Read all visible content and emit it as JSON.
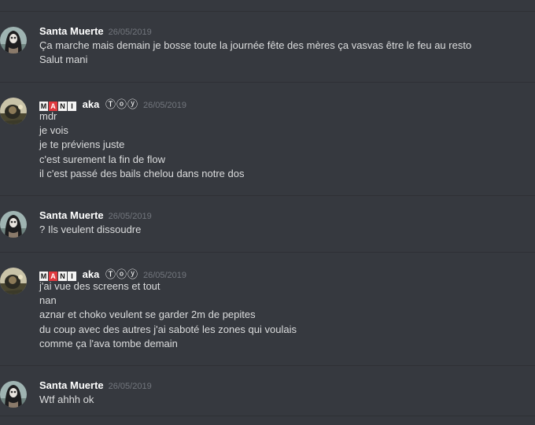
{
  "messages": [
    {
      "author": "Santa Muerte",
      "timestamp": "26/05/2019",
      "lines": [
        "Ça marche mais demain je bosse toute la journée fête des mères ça vasvas être le feu au resto",
        "Salut mani"
      ]
    },
    {
      "author_letters": [
        "M",
        "A",
        "N",
        "I"
      ],
      "author_suffix": "aka",
      "author_circled": "Ⓣⓞⓨ",
      "timestamp": "26/05/2019",
      "lines": [
        "mdr",
        "je vois",
        "je te préviens juste",
        "c'est surement la fin de flow",
        "il c'est passé des bails chelou dans notre dos"
      ]
    },
    {
      "author": "Santa Muerte",
      "timestamp": "26/05/2019",
      "lines": [
        "? Ils veulent dissoudre"
      ]
    },
    {
      "author_letters": [
        "M",
        "A",
        "N",
        "I"
      ],
      "author_suffix": "aka",
      "author_circled": "Ⓣⓞⓨ",
      "timestamp": "26/05/2019",
      "lines": [
        "j'ai vue des screens et tout",
        "nan",
        "aznar et choko veulent se garder 2m de pepites",
        "du coup avec des autres j'ai saboté les zones qui voulais",
        "comme ça l'ava tombe demain"
      ]
    },
    {
      "author": "Santa Muerte",
      "timestamp": "26/05/2019",
      "lines": [
        "Wtf ahhh ok"
      ]
    }
  ],
  "colors": {
    "background": "#36393f",
    "username": "#ffffff",
    "timestamp": "#72767d",
    "message_text": "#dcddde",
    "divider": "#2e3035"
  }
}
